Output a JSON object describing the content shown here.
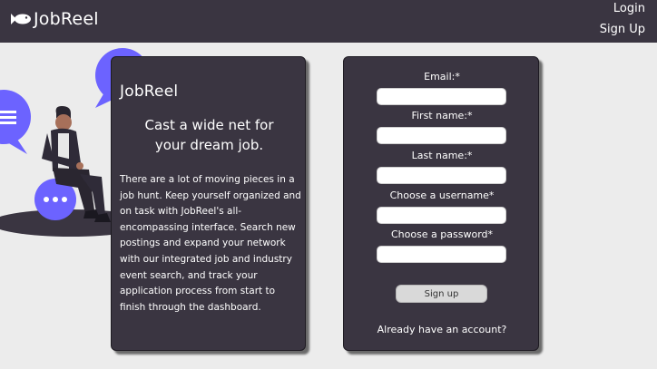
{
  "header": {
    "brand": "JobReel",
    "login": "Login",
    "signup": "Sign Up"
  },
  "info": {
    "logo": "JobReel",
    "tagline_line1": "Cast a wide net for",
    "tagline_line2": "your dream job.",
    "description": "There are a lot of moving pieces in a job hunt. Keep yourself organized and on task with JobReel's all-encompassing interface. Search new postings and expand your network with our integrated job and industry event search, and track your application process from start to finish through the dashboard."
  },
  "form": {
    "email_label": "Email:*",
    "first_name_label": "First name:*",
    "last_name_label": "Last name:*",
    "username_label": "Choose a username*",
    "password_label": "Choose a password*",
    "submit": "Sign up",
    "account_link": "Already have an account?"
  },
  "colors": {
    "header": "#3a3541",
    "accent": "#6c63ff",
    "background": "#ececec"
  }
}
